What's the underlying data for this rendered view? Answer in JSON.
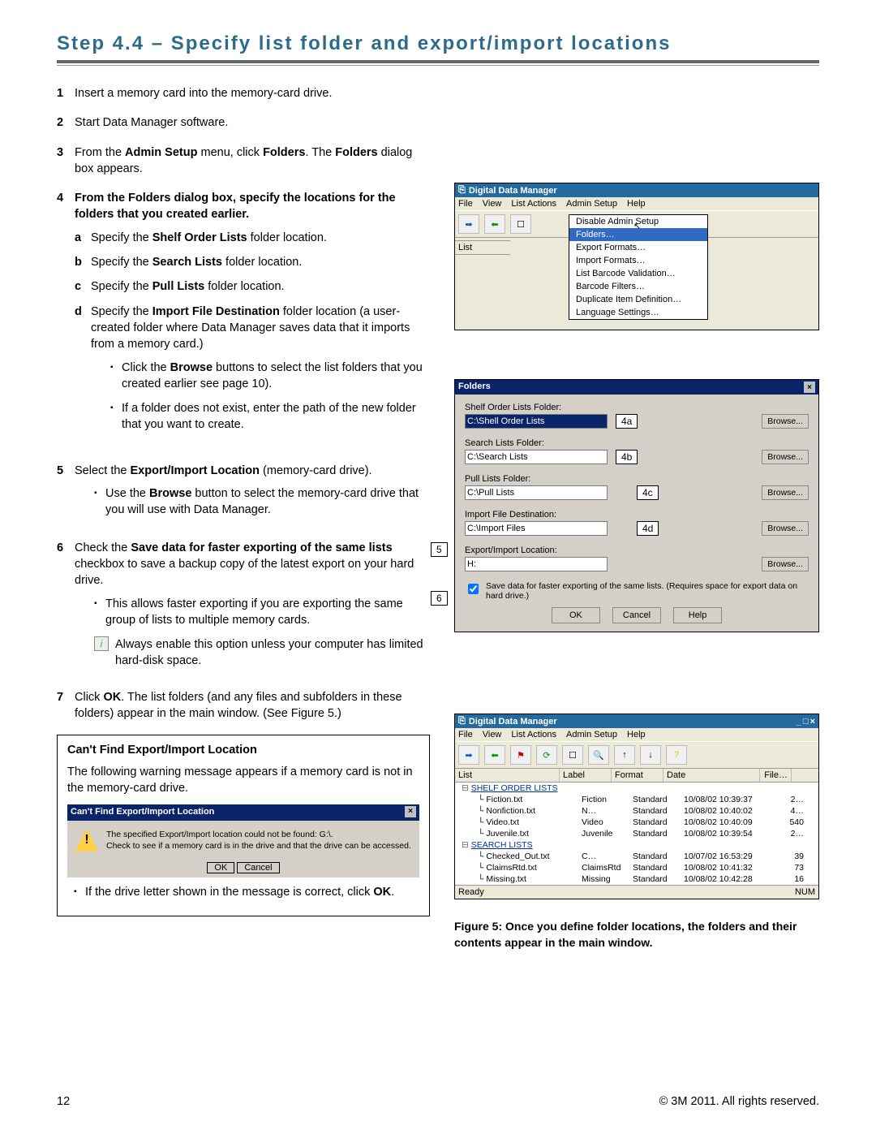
{
  "heading": "Step 4.4 – Specify list folder and export/import locations",
  "steps": {
    "1": "Insert a memory card into the memory-card drive.",
    "2": "Start Data Manager software.",
    "3_a": "From the ",
    "3_b": "Admin Setup",
    "3_c": " menu, click ",
    "3_d": "Folders",
    "3_e": ". The ",
    "3_f": "Folders",
    "3_g": " dialog box appears.",
    "4": "From the Folders dialog box, specify the locations for the folders that you created earlier.",
    "4a_a": "Specify the ",
    "4a_b": "Shelf Order Lists",
    "4a_c": " folder location.",
    "4b_a": "Specify the ",
    "4b_b": "Search Lists",
    "4b_c": " folder location.",
    "4c_a": "Specify the ",
    "4c_b": "Pull Lists",
    "4c_c": " folder location.",
    "4d_a": "Specify the ",
    "4d_b": "Import File Destination",
    "4d_c": " folder location (a user-created folder where Data Manager saves data that it imports from a memory card.)",
    "4bul1_a": "Click the ",
    "4bul1_b": "Browse",
    "4bul1_c": " buttons to select the list folders that you created earlier see page 10).",
    "4bul2": "If a folder does not exist, enter the path of the new folder that you want to create.",
    "5_a": "Select the ",
    "5_b": "Export/Import Location",
    "5_c": " (memory-card drive).",
    "5bul_a": "Use the ",
    "5bul_b": "Browse",
    "5bul_c": " button to select the memory-card drive that you will use with Data Manager.",
    "6_a": "Check the ",
    "6_b": "Save data for faster exporting of the same lists",
    "6_c": " checkbox to save a backup copy of the latest export on your hard drive.",
    "6bul": "This allows faster exporting if you are exporting the same group of lists to multiple memory cards.",
    "tip": "Always enable this option unless your computer has limited hard-disk space.",
    "7_a": "Click ",
    "7_b": "OK",
    "7_c": ". The list folders (and any files and subfolders in these folders) appear in the main window. (See Figure 5.)"
  },
  "box": {
    "title": "Can't Find Export/Import Location",
    "text": "The following warning message appears if a memory card is not in the memory-card drive.",
    "dlg_title": "Can't Find Export/Import Location",
    "dlg_body1": "The specified Export/Import location could not be found: G:\\.",
    "dlg_body2": "Check to see if a memory card is in the drive and that the drive can be accessed.",
    "ok": "OK",
    "cancel": "Cancel",
    "after_a": "If the drive letter shown in the message is correct, click ",
    "after_b": "OK",
    "after_c": "."
  },
  "shot1": {
    "title": "Digital Data Manager",
    "menu": [
      "File",
      "View",
      "List Actions",
      "Admin Setup",
      "Help"
    ],
    "list": "List",
    "dropdown": [
      "Disable Admin Setup",
      "Folders…",
      "Export Formats…",
      "Import Formats…",
      "List Barcode Validation…",
      "Barcode Filters…",
      "Duplicate Item Definition…",
      "Language Settings…"
    ]
  },
  "folders": {
    "title": "Folders",
    "rows": [
      {
        "label": "Shelf Order Lists Folder:",
        "value": "C:\\Shell Order Lists",
        "sel": true,
        "call": "4a"
      },
      {
        "label": "Search Lists Folder:",
        "value": "C:\\Search Lists",
        "call": "4b"
      },
      {
        "label": "Pull Lists Folder:",
        "value": "C:\\Pull Lists",
        "call": "4c"
      },
      {
        "label": "Import File Destination:",
        "value": "C:\\Import Files",
        "call": "4d"
      },
      {
        "label": "Export/Import Location:",
        "value": "H:",
        "call": "5",
        "leftcall": true
      }
    ],
    "browse": "Browse...",
    "cb": "Save data for faster exporting of the same lists. (Requires space for export data on hard drive.)",
    "ok": "OK",
    "cancel": "Cancel",
    "help": "Help",
    "leftcall6": "6"
  },
  "shot3": {
    "title": "Digital Data Manager",
    "menu": [
      "File",
      "View",
      "List Actions",
      "Admin Setup",
      "Help"
    ],
    "cols": [
      "List",
      "Label",
      "Format",
      "Date",
      "File…"
    ],
    "nodes": [
      {
        "t": "SHELF ORDER LISTS",
        "hdr": true
      },
      {
        "t": "Fiction.txt",
        "l": "Fiction",
        "f": "Standard",
        "d": "10/08/02 10:39:37",
        "s": "2…"
      },
      {
        "t": "Nonfiction.txt",
        "l": "N…",
        "f": "Standard",
        "d": "10/08/02 10:40:02",
        "s": "4…"
      },
      {
        "t": "Video.txt",
        "l": "Video",
        "f": "Standard",
        "d": "10/08/02 10:40:09",
        "s": "540"
      },
      {
        "t": "Juvenile.txt",
        "l": "Juvenile",
        "f": "Standard",
        "d": "10/08/02 10:39:54",
        "s": "2…"
      },
      {
        "t": "SEARCH LISTS",
        "hdr": true
      },
      {
        "t": "Checked_Out.txt",
        "l": "C…",
        "f": "Standard",
        "d": "10/07/02 16:53:29",
        "s": "39"
      },
      {
        "t": "ClaimsRtd.txt",
        "l": "ClaimsRtd",
        "f": "Standard",
        "d": "10/08/02 10:41:32",
        "s": "73"
      },
      {
        "t": "Missing.txt",
        "l": "Missing",
        "f": "Standard",
        "d": "10/08/02 10:42:28",
        "s": "16"
      }
    ],
    "status": "Ready",
    "num": "NUM"
  },
  "caption": "Figure 5: Once you define folder locations, the folders and their contents appear in the main window.",
  "footer": {
    "page": "12",
    "copy": "© 3M 2011. All rights reserved."
  }
}
